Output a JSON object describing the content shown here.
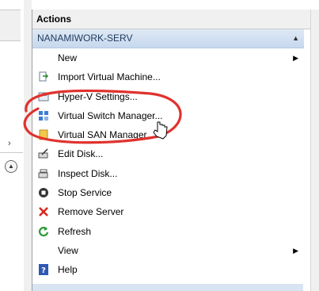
{
  "actions": {
    "title": "Actions",
    "section": "NANAMIWORK-SERV",
    "items": [
      {
        "label": "New",
        "icon": "none",
        "submenu": true
      },
      {
        "label": "Import Virtual Machine...",
        "icon": "import-icon"
      },
      {
        "label": "Hyper-V Settings...",
        "icon": "settings-icon"
      },
      {
        "label": "Virtual Switch Manager...",
        "icon": "switch-icon"
      },
      {
        "label": "Virtual SAN Manager...",
        "icon": "san-icon"
      },
      {
        "label": "Edit Disk...",
        "icon": "edit-disk-icon"
      },
      {
        "label": "Inspect Disk...",
        "icon": "inspect-disk-icon"
      },
      {
        "label": "Stop Service",
        "icon": "stop-icon"
      },
      {
        "label": "Remove Server",
        "icon": "remove-icon"
      },
      {
        "label": "Refresh",
        "icon": "refresh-icon"
      },
      {
        "label": "View",
        "icon": "none",
        "submenu": true
      },
      {
        "label": "Help",
        "icon": "help-icon"
      }
    ]
  },
  "colors": {
    "section_text": "#1e395b",
    "annotation": "#e0322e",
    "remove": "#d9261c",
    "refresh": "#2a9a32",
    "help": "#2d58b5"
  }
}
